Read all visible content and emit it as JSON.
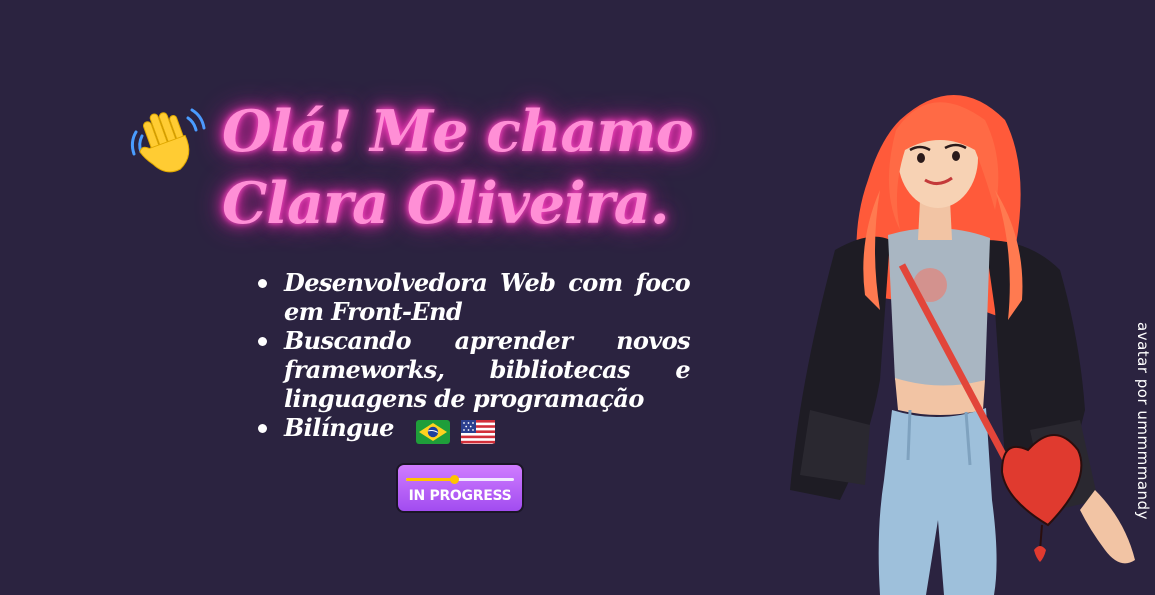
{
  "header": {
    "wave_icon": "waving-hand-icon",
    "title_line1": "Olá! Me chamo",
    "title_line2": "Clara Oliveira."
  },
  "bio": {
    "items": [
      "Desenvolvedora Web com foco em Front-End",
      "Buscando aprender novos frameworks, bibliotecas e linguagens de programação",
      "Bilíngue"
    ],
    "flags": [
      "brazil-flag-icon",
      "usa-flag-icon"
    ]
  },
  "badge": {
    "label": "IN PROGRESS",
    "progress": 0.44
  },
  "avatar": {
    "credit": "avatar por ummmmandy"
  },
  "colors": {
    "background": "#2b2340",
    "neon_pink": "#ff8fd6",
    "badge_purple": "#b35ef5",
    "progress_yellow": "#ffc400",
    "hair": "#ff5a3a"
  }
}
